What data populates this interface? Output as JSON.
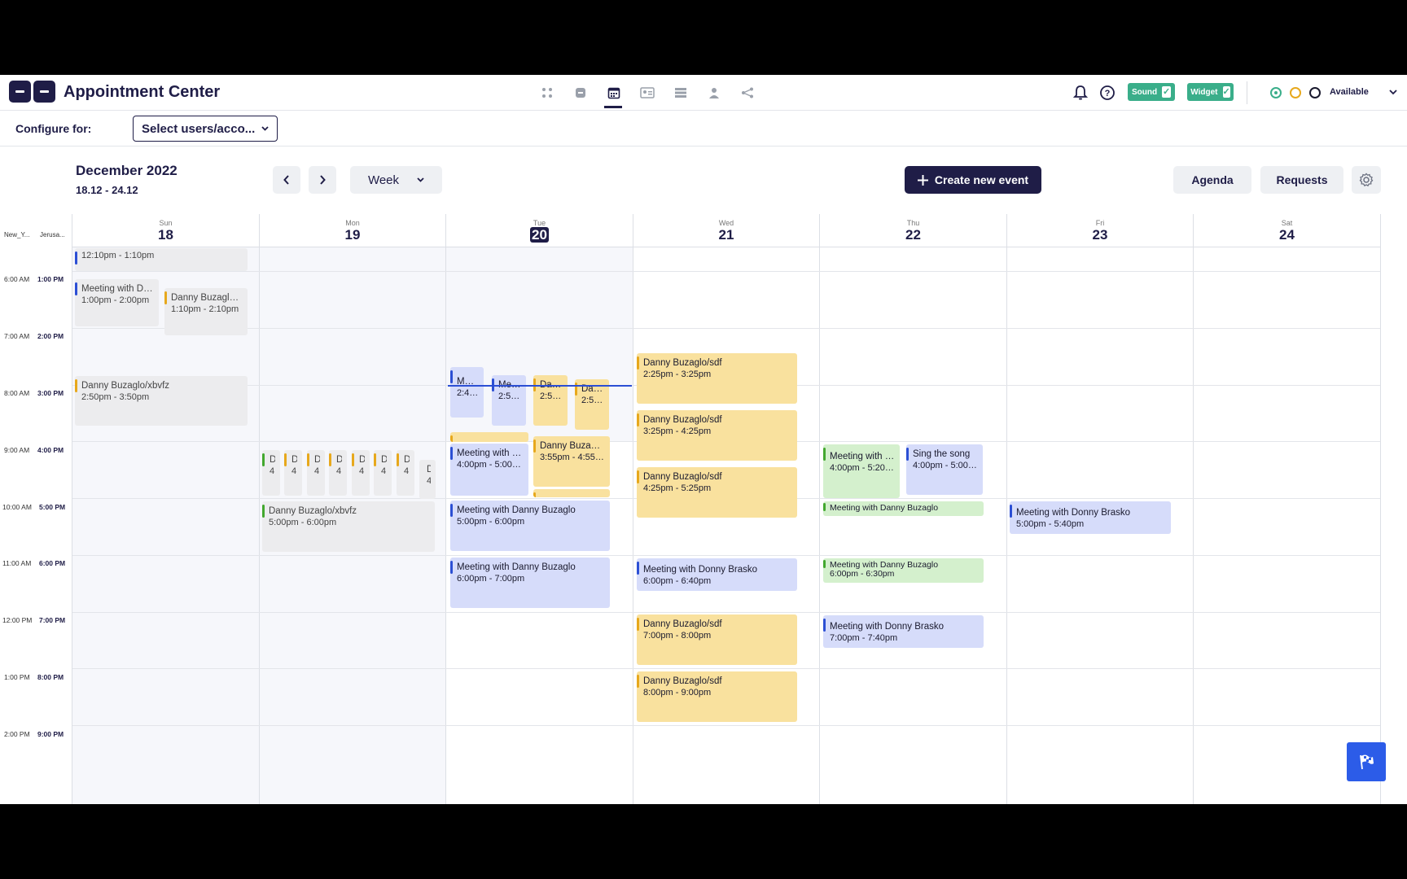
{
  "header": {
    "title": "Appointment Center",
    "sound_label": "Sound",
    "widget_label": "Widget",
    "status_label": "Available"
  },
  "config": {
    "label": "Configure for:",
    "select_value": "Select users/acco..."
  },
  "calendar": {
    "month": "December 2022",
    "range": "18.12 - 24.12",
    "view": "Week",
    "create_label": "Create new event",
    "agenda_label": "Agenda",
    "requests_label": "Requests",
    "tz1": "New_Y...",
    "tz2": "Jerusa...",
    "days": [
      {
        "name": "Sun",
        "num": "18"
      },
      {
        "name": "Mon",
        "num": "19"
      },
      {
        "name": "Tue",
        "num": "20"
      },
      {
        "name": "Wed",
        "num": "21"
      },
      {
        "name": "Thu",
        "num": "22"
      },
      {
        "name": "Fri",
        "num": "23"
      },
      {
        "name": "Sat",
        "num": "24"
      }
    ],
    "times": [
      {
        "a": "6:00 AM",
        "b": "1:00 PM"
      },
      {
        "a": "7:00 AM",
        "b": "2:00 PM"
      },
      {
        "a": "8:00 AM",
        "b": "3:00 PM"
      },
      {
        "a": "9:00 AM",
        "b": "4:00 PM"
      },
      {
        "a": "10:00 AM",
        "b": "5:00 PM"
      },
      {
        "a": "11:00 AM",
        "b": "6:00 PM"
      },
      {
        "a": "12:00 PM",
        "b": "7:00 PM"
      },
      {
        "a": "1:00 PM",
        "b": "8:00 PM"
      },
      {
        "a": "2:00 PM",
        "b": "9:00 PM"
      }
    ],
    "events": [
      {
        "t1": "",
        "t2": "12:10pm - 1:10pm"
      },
      {
        "t1": "Meeting with Da...",
        "t2": "1:00pm - 2:00pm"
      },
      {
        "t1": "Danny Buzaglo/...",
        "t2": "1:10pm - 2:10pm"
      },
      {
        "t1": "Danny Buzaglo/xbvfz",
        "t2": "2:50pm - 3:50pm"
      },
      {
        "t1": "D.",
        "t2": "4."
      },
      {
        "t1": "Danny Buzaglo/xbvfz",
        "t2": "5:00pm - 6:00pm"
      },
      {
        "t1": "Meet...",
        "t2": "2:40p..."
      },
      {
        "t1": "Meet...",
        "t2": "2:50p..."
      },
      {
        "t1": "Dann...",
        "t2": "2:50p..."
      },
      {
        "t1": "Dann...",
        "t2": "2:55p..."
      },
      {
        "t1": "Meeting with D...",
        "t2": "4:00pm - 5:00pm"
      },
      {
        "t1": "Danny Buzaglo...",
        "t2": "3:55pm - 4:55pm"
      },
      {
        "t1": "Meeting with Danny Buzaglo",
        "t2": "5:00pm - 6:00pm"
      },
      {
        "t1": "Meeting with Danny Buzaglo",
        "t2": "6:00pm - 7:00pm"
      },
      {
        "t1": "Danny Buzaglo/sdf",
        "t2": "2:25pm - 3:25pm"
      },
      {
        "t1": "Danny Buzaglo/sdf",
        "t2": "3:25pm - 4:25pm"
      },
      {
        "t1": "Danny Buzaglo/sdf",
        "t2": "4:25pm - 5:25pm"
      },
      {
        "t1": "Meeting with Donny Brasko",
        "t2": "6:00pm - 6:40pm"
      },
      {
        "t1": "Danny Buzaglo/sdf",
        "t2": "7:00pm - 8:00pm"
      },
      {
        "t1": "Danny Buzaglo/sdf",
        "t2": "8:00pm - 9:00pm"
      },
      {
        "t1": "Meeting with H...",
        "t2": "4:00pm - 5:20pm"
      },
      {
        "t1": "Sing the song",
        "t2": "4:00pm - 5:00pm"
      },
      {
        "t1": "Meeting with Danny Buzaglo",
        "t2": ""
      },
      {
        "t1": "Meeting with Danny Buzaglo",
        "t2": "6:00pm - 6:30pm"
      },
      {
        "t1": "Meeting with Donny Brasko",
        "t2": "7:00pm - 7:40pm"
      },
      {
        "t1": "Meeting with Donny Brasko",
        "t2": "5:00pm - 5:40pm"
      }
    ]
  },
  "colors": {
    "primary": "#1f1d47",
    "toggle_on": "#3aae8a",
    "event_yellow": "#f9e19e",
    "event_blue": "#d6dcfa",
    "event_green": "#d4f0cd",
    "flag_button": "#2c5ce8"
  }
}
